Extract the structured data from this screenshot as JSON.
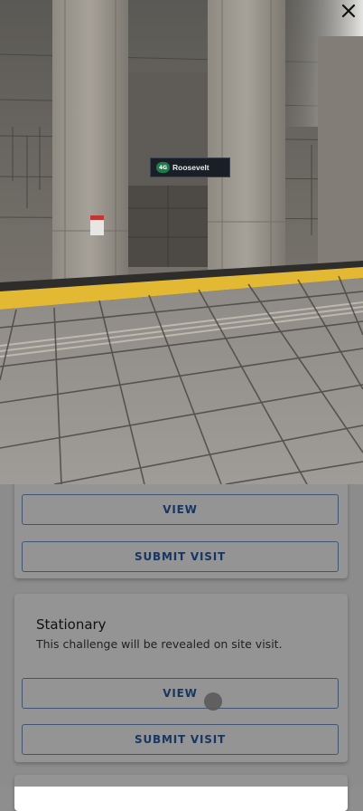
{
  "viewer": {
    "close_icon": "close-icon",
    "photo_sign": {
      "badge": "4G",
      "station": "Roosevelt"
    }
  },
  "cards": [
    {
      "view_label": "VIEW",
      "submit_label": "SUBMIT VISIT"
    },
    {
      "title": "Stationary",
      "description": "This challenge will be revealed on site visit.",
      "view_label": "VIEW",
      "submit_label": "SUBMIT VISIT"
    }
  ],
  "colors": {
    "accent": "#2a5ea8",
    "button_border": "#6f93c4",
    "tactile_strip": "#e3b934"
  }
}
